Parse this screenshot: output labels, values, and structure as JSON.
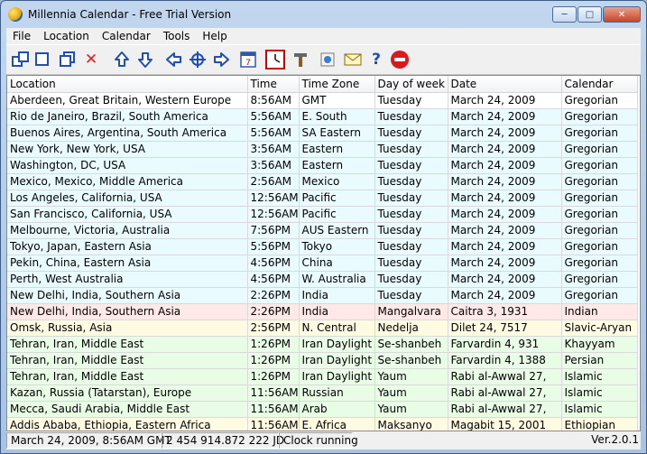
{
  "window": {
    "title": "Millennia Calendar - Free Trial Version"
  },
  "menu": [
    "File",
    "Location",
    "Calendar",
    "Tools",
    "Help"
  ],
  "toolbar": [
    {
      "icon": "cascade-windows-icon"
    },
    {
      "icon": "single-window-icon"
    },
    {
      "icon": "tile-windows-icon"
    },
    {
      "icon": "delete-icon"
    },
    {
      "icon": "move-up-icon"
    },
    {
      "icon": "move-down-icon"
    },
    {
      "icon": "arrow-left-icon"
    },
    {
      "icon": "target-icon"
    },
    {
      "icon": "arrow-right-icon"
    },
    {
      "icon": "calendar-icon"
    },
    {
      "icon": "clock-icon"
    },
    {
      "icon": "tools-icon"
    },
    {
      "icon": "photo-icon"
    },
    {
      "icon": "email-icon"
    },
    {
      "icon": "help-icon"
    },
    {
      "icon": "stop-icon"
    }
  ],
  "table": {
    "columns": [
      "Location",
      "Time",
      "Time Zone",
      "Day of week",
      "Date",
      "Calendar"
    ],
    "rows": [
      {
        "color": "selected",
        "cells": [
          "Aberdeen, Great Britain, Western Europe",
          "8:56AM",
          "GMT",
          "Tuesday",
          "March 24, 2009",
          "Gregorian"
        ]
      },
      {
        "color": "cyan",
        "cells": [
          "Rio de Janeiro, Brazil, South America",
          "5:56AM",
          "E. South",
          "Tuesday",
          "March 24, 2009",
          "Gregorian"
        ]
      },
      {
        "color": "cyan",
        "cells": [
          "Buenos Aires, Argentina, South America",
          "5:56AM",
          "SA Eastern",
          "Tuesday",
          "March 24, 2009",
          "Gregorian"
        ]
      },
      {
        "color": "cyan",
        "cells": [
          "New York, New York, USA",
          "3:56AM",
          "Eastern",
          "Tuesday",
          "March 24, 2009",
          "Gregorian"
        ]
      },
      {
        "color": "cyan",
        "cells": [
          "Washington, DC, USA",
          "3:56AM",
          "Eastern",
          "Tuesday",
          "March 24, 2009",
          "Gregorian"
        ]
      },
      {
        "color": "cyan",
        "cells": [
          "Mexico, Mexico, Middle America",
          "2:56AM",
          "Mexico",
          "Tuesday",
          "March 24, 2009",
          "Gregorian"
        ]
      },
      {
        "color": "cyan",
        "cells": [
          "Los Angeles, California, USA",
          "12:56AM",
          "Pacific",
          "Tuesday",
          "March 24, 2009",
          "Gregorian"
        ]
      },
      {
        "color": "cyan",
        "cells": [
          "San Francisco, California, USA",
          "12:56AM",
          "Pacific",
          "Tuesday",
          "March 24, 2009",
          "Gregorian"
        ]
      },
      {
        "color": "cyan",
        "cells": [
          "Melbourne, Victoria, Australia",
          "7:56PM",
          "AUS Eastern",
          "Tuesday",
          "March 24, 2009",
          "Gregorian"
        ]
      },
      {
        "color": "cyan",
        "cells": [
          "Tokyo, Japan, Eastern Asia",
          "5:56PM",
          "Tokyo",
          "Tuesday",
          "March 24, 2009",
          "Gregorian"
        ]
      },
      {
        "color": "cyan",
        "cells": [
          "Pekin, China, Eastern Asia",
          "4:56PM",
          "China",
          "Tuesday",
          "March 24, 2009",
          "Gregorian"
        ]
      },
      {
        "color": "cyan",
        "cells": [
          "Perth, West Australia",
          "4:56PM",
          "W. Australia",
          "Tuesday",
          "March 24, 2009",
          "Gregorian"
        ]
      },
      {
        "color": "cyan",
        "cells": [
          "New Delhi, India, Southern Asia",
          "2:26PM",
          "India",
          "Tuesday",
          "March 24, 2009",
          "Gregorian"
        ]
      },
      {
        "color": "pink",
        "cells": [
          "New Delhi, India, Southern Asia",
          "2:26PM",
          "India",
          "Mangalvara",
          "Caitra 3, 1931",
          "Indian"
        ]
      },
      {
        "color": "yellow",
        "cells": [
          "Omsk, Russia, Asia",
          "2:56PM",
          "N. Central",
          "Nedelja",
          "Dilet 24, 7517",
          "Slavic-Aryan"
        ]
      },
      {
        "color": "green",
        "cells": [
          "Tehran, Iran, Middle East",
          "1:26PM",
          "Iran Daylight",
          "Se-shanbeh",
          "Farvardin 4, 931",
          "Khayyam"
        ]
      },
      {
        "color": "green",
        "cells": [
          "Tehran, Iran, Middle East",
          "1:26PM",
          "Iran Daylight",
          "Se-shanbeh",
          "Farvardin 4, 1388",
          "Persian"
        ]
      },
      {
        "color": "green",
        "cells": [
          "Tehran, Iran, Middle East",
          "1:26PM",
          "Iran Daylight",
          "Yaum",
          "Rabi al-Awwal 27,",
          "Islamic"
        ]
      },
      {
        "color": "green",
        "cells": [
          "Kazan, Russia (Tatarstan), Europe",
          "11:56AM",
          "Russian",
          "Yaum",
          "Rabi al-Awwal 27,",
          "Islamic"
        ]
      },
      {
        "color": "green",
        "cells": [
          "Mecca, Saudi Arabia, Middle East",
          "11:56AM",
          "Arab",
          "Yaum",
          "Rabi al-Awwal 27,",
          "Islamic"
        ]
      },
      {
        "color": "yellow",
        "cells": [
          "Addis Ababa, Ethiopia, Eastern Africa",
          "11:56AM",
          "E. Africa",
          "Maksanyo",
          "Magabit 15, 2001",
          "Ethiopian"
        ]
      }
    ]
  },
  "status": {
    "datetime": "March 24, 2009, 8:56AM GMT",
    "julian": "2 454 914.872 222 JD",
    "clock": "Clock running",
    "version": "Ver.2.0.1"
  },
  "colors": {
    "selected": "#3399ff",
    "cyan": "#e9fbff",
    "pink": "#ffe8e8",
    "yellow": "#fffbe3",
    "green": "#e8fce6"
  }
}
